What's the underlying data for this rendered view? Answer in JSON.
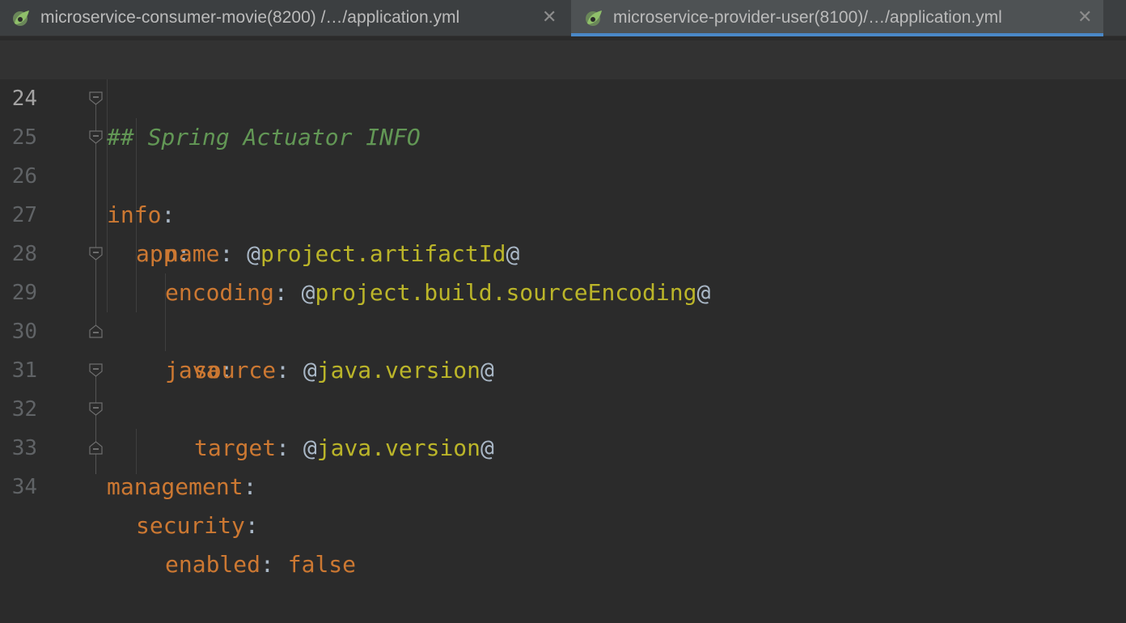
{
  "tabs": [
    {
      "label": "microservice-consumer-movie(8200)  /…/application.yml",
      "close": "✕",
      "icon": "spring-leaf-icon"
    },
    {
      "label": "microservice-provider-user(8100)/…/application.yml",
      "close": "✕",
      "icon": "spring-leaf-icon"
    }
  ],
  "colors": {
    "background": "#2b2b2b",
    "comment": "#629755",
    "key": "#cc7832",
    "value": "#bbb529",
    "punctuation": "#a9b7c6"
  },
  "editor": {
    "lines": [
      {
        "num": "24",
        "comment": "## Spring Actuator INFO"
      },
      {
        "num": "25",
        "key": "info",
        "colon": ":"
      },
      {
        "num": "26",
        "key": "app",
        "colon": ":"
      },
      {
        "num": "27",
        "key": "name",
        "colon": ":",
        "at1": "@",
        "value": "project.artifactId",
        "at2": "@"
      },
      {
        "num": "28",
        "key": "encoding",
        "colon": ":",
        "at1": "@",
        "value": "project.build.sourceEncoding",
        "at2": "@"
      },
      {
        "num": "29",
        "key": "java",
        "colon": ":"
      },
      {
        "num": "30",
        "key": "source",
        "colon": ":",
        "at1": "@",
        "value": "java.version",
        "at2": "@"
      },
      {
        "num": "31",
        "key": "target",
        "colon": ":",
        "at1": "@",
        "value": "java.version",
        "at2": "@"
      },
      {
        "num": "32",
        "key": "management",
        "colon": ":"
      },
      {
        "num": "33",
        "key": "security",
        "colon": ":"
      },
      {
        "num": "34",
        "key": "enabled",
        "colon": ":",
        "plain": "false"
      }
    ]
  }
}
